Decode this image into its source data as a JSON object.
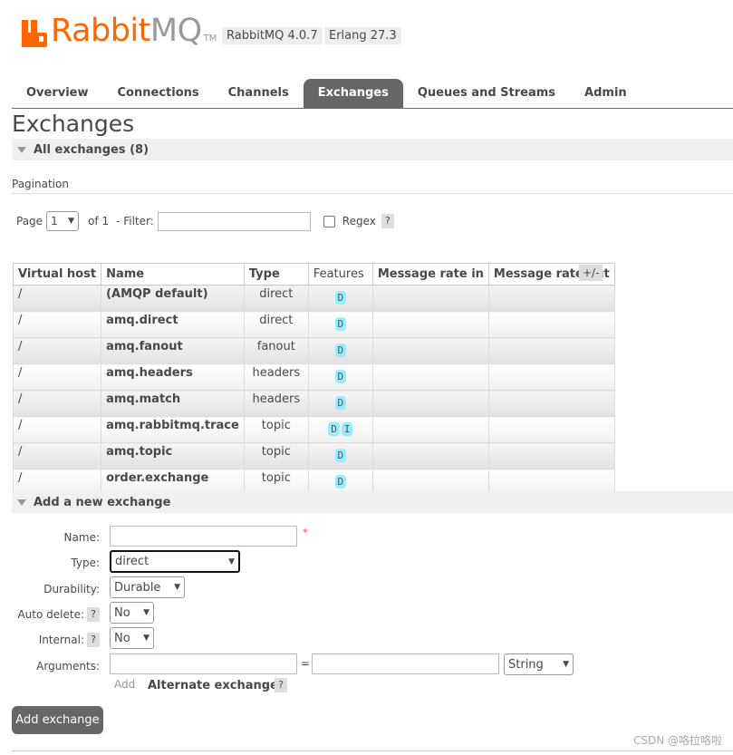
{
  "brand": {
    "rabbit": "Rabbit",
    "mq": "MQ",
    "tm": "TM"
  },
  "versions": [
    "RabbitMQ 4.0.7",
    "Erlang 27.3"
  ],
  "tabs": [
    {
      "label": "Overview",
      "active": false
    },
    {
      "label": "Connections",
      "active": false
    },
    {
      "label": "Channels",
      "active": false
    },
    {
      "label": "Exchanges",
      "active": true
    },
    {
      "label": "Queues and Streams",
      "active": false
    },
    {
      "label": "Admin",
      "active": false
    }
  ],
  "page_title": "Exchanges",
  "all_exchanges": "All exchanges (8)",
  "pagination": {
    "title": "Pagination",
    "page_label": "Page",
    "page_value": "1",
    "of_label": "of 1",
    "filter_label": "- Filter:",
    "filter_value": "",
    "regex_label": "Regex",
    "help": "?"
  },
  "table": {
    "headers": [
      "Virtual host",
      "Name",
      "Type",
      "Features",
      "Message rate in",
      "Message rate out"
    ],
    "toggle": "+/-",
    "rows": [
      {
        "vhost": "/",
        "name": "(AMQP default)",
        "type": "direct",
        "features": [
          "D"
        ]
      },
      {
        "vhost": "/",
        "name": "amq.direct",
        "type": "direct",
        "features": [
          "D"
        ]
      },
      {
        "vhost": "/",
        "name": "amq.fanout",
        "type": "fanout",
        "features": [
          "D"
        ]
      },
      {
        "vhost": "/",
        "name": "amq.headers",
        "type": "headers",
        "features": [
          "D"
        ]
      },
      {
        "vhost": "/",
        "name": "amq.match",
        "type": "headers",
        "features": [
          "D"
        ]
      },
      {
        "vhost": "/",
        "name": "amq.rabbitmq.trace",
        "type": "topic",
        "features": [
          "D",
          "I"
        ]
      },
      {
        "vhost": "/",
        "name": "amq.topic",
        "type": "topic",
        "features": [
          "D"
        ]
      },
      {
        "vhost": "/",
        "name": "order.exchange",
        "type": "topic",
        "features": [
          "D"
        ]
      }
    ]
  },
  "add_section": {
    "title": "Add a new exchange",
    "name_label": "Name:",
    "name_value": "",
    "required_mark": "*",
    "type_label": "Type:",
    "type_value": "direct",
    "durability_label": "Durability:",
    "durability_value": "Durable",
    "auto_delete_label": "Auto delete:",
    "auto_delete_value": "No",
    "internal_label": "Internal:",
    "internal_value": "No",
    "arguments_label": "Arguments:",
    "equals": "=",
    "arg_type_value": "String",
    "add_link": "Add",
    "alternate_exchange": "Alternate exchange",
    "help": "?",
    "submit": "Add exchange"
  },
  "watermark": "CSDN @咯拉咯啦",
  "colors": {
    "brand_orange": "#ff6600",
    "tab_active": "#666666",
    "feature_badge": "#99ebff"
  }
}
